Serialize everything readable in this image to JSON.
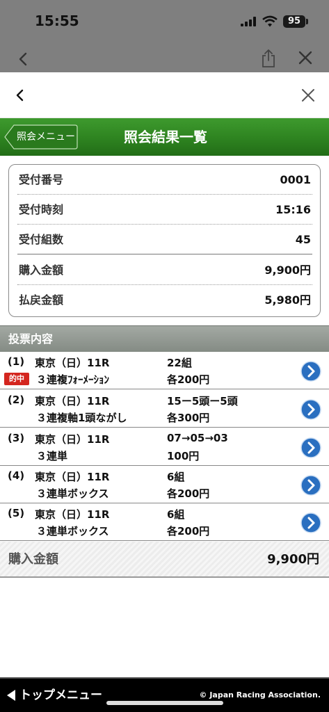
{
  "status_bar": {
    "time": "15:55",
    "battery": "95"
  },
  "header": {
    "menu_button": "照会メニュー",
    "title": "照会結果一覧"
  },
  "receipt": [
    {
      "label": "受付番号",
      "value": "0001"
    },
    {
      "label": "受付時刻",
      "value": "15:16"
    },
    {
      "label": "受付組数",
      "value": "45"
    },
    {
      "label": "購入金額",
      "value": "9,900円"
    },
    {
      "label": "払戻金額",
      "value": "5,980円"
    }
  ],
  "bets_section": {
    "title": "投票内容"
  },
  "bets": [
    {
      "no": "(1)",
      "race": "東京（日）11R",
      "type": "３連複ﾌｫｰﾒｰｼｮﾝ",
      "combo": "22組",
      "amount": "各200円",
      "hit": "的中"
    },
    {
      "no": "(2)",
      "race": "東京（日）11R",
      "type": "３連複軸1頭ながし",
      "combo": "15ー5頭ー5頭",
      "amount": "各300円"
    },
    {
      "no": "(3)",
      "race": "東京（日）11R",
      "type": "３連単",
      "combo": "07→05→03",
      "amount": "100円"
    },
    {
      "no": "(4)",
      "race": "東京（日）11R",
      "type": "３連単ボックス",
      "combo": "6組",
      "amount": "各200円"
    },
    {
      "no": "(5)",
      "race": "東京（日）11R",
      "type": "３連単ボックス",
      "combo": "6組",
      "amount": "各200円"
    }
  ],
  "total": {
    "label": "購入金額",
    "value": "9,900円"
  },
  "footer": {
    "top_menu": "トップメニュー",
    "copyright": "© Japan Racing Association."
  },
  "colors": {
    "header_green": "#2f8521",
    "hit_red": "#d4261f",
    "section_gray": "#8f968f",
    "detail_blue": "#2a6fc0"
  }
}
